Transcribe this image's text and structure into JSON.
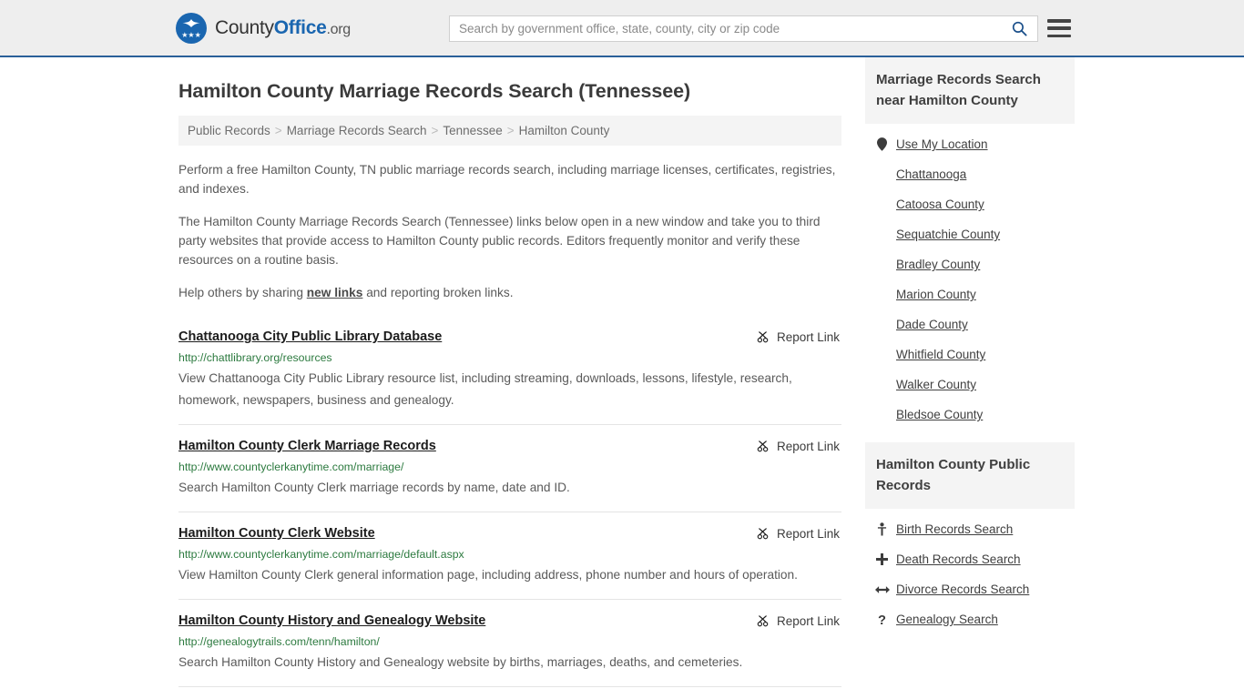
{
  "header": {
    "brand": {
      "part1": "County",
      "part2": "Office",
      "part3": ".org",
      "logo_icon": "eagle-shield-logo"
    },
    "search": {
      "placeholder": "Search by government office, state, county, city or zip code",
      "value": "",
      "search_icon": "search-icon"
    },
    "menu_icon": "hamburger-menu-icon",
    "accent_color": "#2a6099",
    "background_color": "#eeeeee"
  },
  "page": {
    "title": "Hamilton County Marriage Records Search (Tennessee)"
  },
  "breadcrumb": {
    "separator": ">",
    "items": [
      {
        "label": "Public Records"
      },
      {
        "label": "Marriage Records Search"
      },
      {
        "label": "Tennessee"
      },
      {
        "label": "Hamilton County"
      }
    ]
  },
  "intro": {
    "paragraph1": "Perform a free Hamilton County, TN public marriage records search, including marriage licenses, certificates, registries, and indexes.",
    "paragraph2": "The Hamilton County Marriage Records Search (Tennessee) links below open in a new window and take you to third party websites that provide access to Hamilton County public records. Editors frequently monitor and verify these resources on a routine basis.",
    "paragraph3_before": "Help others by sharing ",
    "paragraph3_link": "new links",
    "paragraph3_after": " and reporting broken links."
  },
  "results": {
    "report_label": "Report Link",
    "report_icon": "broken-link-icon",
    "items": [
      {
        "title": "Chattanooga City Public Library Database",
        "url": "http://chattlibrary.org/resources",
        "description": "View Chattanooga City Public Library resource list, including streaming, downloads, lessons, lifestyle, research, homework, newspapers, business and genealogy."
      },
      {
        "title": "Hamilton County Clerk Marriage Records",
        "url": "http://www.countyclerkanytime.com/marriage/",
        "description": "Search Hamilton County Clerk marriage records by name, date and ID."
      },
      {
        "title": "Hamilton County Clerk Website",
        "url": "http://www.countyclerkanytime.com/marriage/default.aspx",
        "description": "View Hamilton County Clerk general information page, including address, phone number and hours of operation."
      },
      {
        "title": "Hamilton County History and Genealogy Website",
        "url": "http://genealogytrails.com/tenn/hamilton/",
        "description": "Search Hamilton County History and Genealogy website by births, marriages, deaths, and cemeteries."
      }
    ]
  },
  "sidebar": {
    "nearby": {
      "heading": "Marriage Records Search near Hamilton County",
      "items": [
        {
          "label": "Use My Location",
          "icon": "map-pin-icon"
        },
        {
          "label": "Chattanooga",
          "icon": ""
        },
        {
          "label": "Catoosa County",
          "icon": ""
        },
        {
          "label": "Sequatchie County",
          "icon": ""
        },
        {
          "label": "Bradley County",
          "icon": ""
        },
        {
          "label": "Marion County",
          "icon": ""
        },
        {
          "label": "Dade County",
          "icon": ""
        },
        {
          "label": "Whitfield County",
          "icon": ""
        },
        {
          "label": "Walker County",
          "icon": ""
        },
        {
          "label": "Bledsoe County",
          "icon": ""
        }
      ]
    },
    "public_records": {
      "heading": "Hamilton County Public Records",
      "items": [
        {
          "label": "Birth Records Search",
          "icon": "baby-icon"
        },
        {
          "label": "Death Records Search",
          "icon": "cross-icon"
        },
        {
          "label": "Divorce Records Search",
          "icon": "left-right-arrow-icon"
        },
        {
          "label": "Genealogy Search",
          "icon": "question-mark-icon"
        }
      ]
    }
  },
  "colors": {
    "link_green": "#2c7a3f",
    "brand_blue": "#1a66b0",
    "text_gray": "#5a5a5a"
  }
}
